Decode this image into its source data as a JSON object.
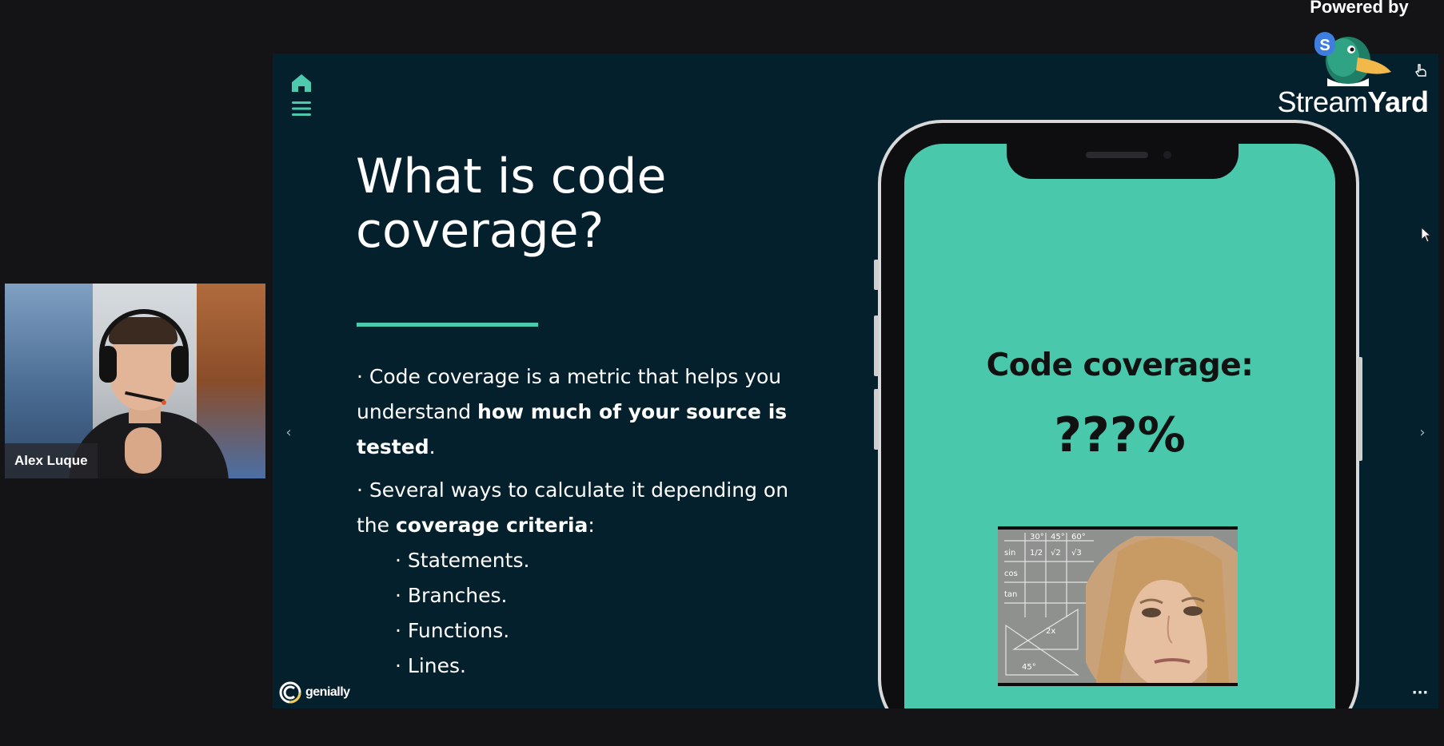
{
  "participant": {
    "name": "Alex Luque"
  },
  "slide": {
    "title": "What is code\ncoverage?",
    "bullet1": {
      "prefix": "· Code coverage is a metric that helps you understand ",
      "bold": "how much of your source is tested",
      "suffix": "."
    },
    "bullet2": {
      "prefix": "· Several ways to calculate it depending on the ",
      "bold": "coverage criteria",
      "suffix": ":"
    },
    "criteria": [
      "· Statements.",
      "· Branches.",
      "· Functions.",
      "· Lines."
    ],
    "nav_prev": "‹",
    "nav_next": "›",
    "more": "···",
    "accent_color": "#4dc9ad",
    "background_color": "#04202d"
  },
  "phone_screen": {
    "heading": "Code coverage:",
    "value": "???%",
    "background_color": "#49c8ac"
  },
  "genially": {
    "label": "genially"
  },
  "branding": {
    "powered_by": "Powered by",
    "name_part1": "Stream",
    "name_part2": "Yard"
  }
}
